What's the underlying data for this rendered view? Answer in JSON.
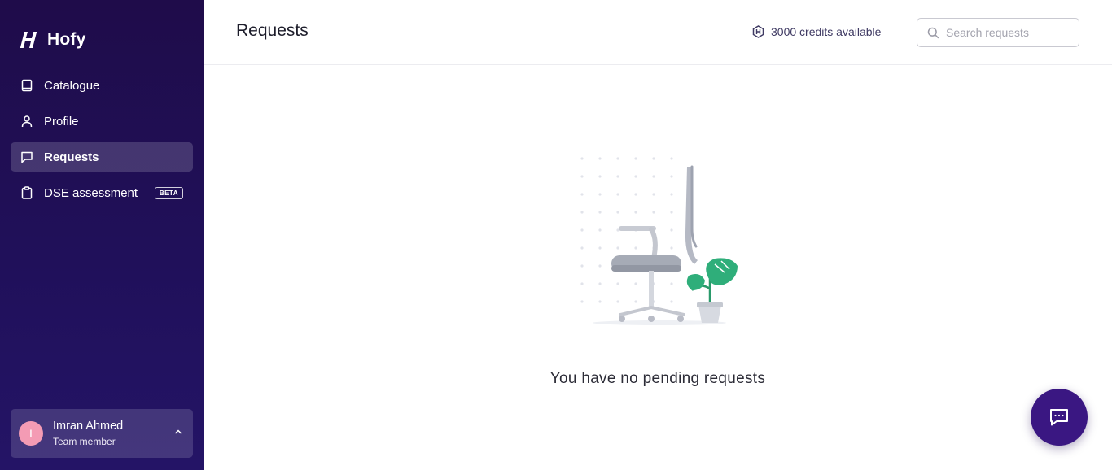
{
  "brand": {
    "name": "Hofy"
  },
  "nav": {
    "items": [
      {
        "label": "Catalogue",
        "icon": "book-icon"
      },
      {
        "label": "Profile",
        "icon": "user-icon"
      },
      {
        "label": "Requests",
        "icon": "message-icon",
        "active": true
      },
      {
        "label": "DSE assessment",
        "icon": "clipboard-icon",
        "badge": "BETA"
      }
    ]
  },
  "user": {
    "initial": "I",
    "name": "Imran Ahmed",
    "role": "Team member"
  },
  "header": {
    "title": "Requests",
    "credits": "3000 credits available",
    "search_placeholder": "Search requests"
  },
  "main": {
    "empty_message": "You have no pending requests"
  },
  "colors": {
    "sidebar": "#20105a",
    "accent": "#3a1782",
    "avatar": "#f49bb4",
    "plant": "#2fae7a"
  }
}
